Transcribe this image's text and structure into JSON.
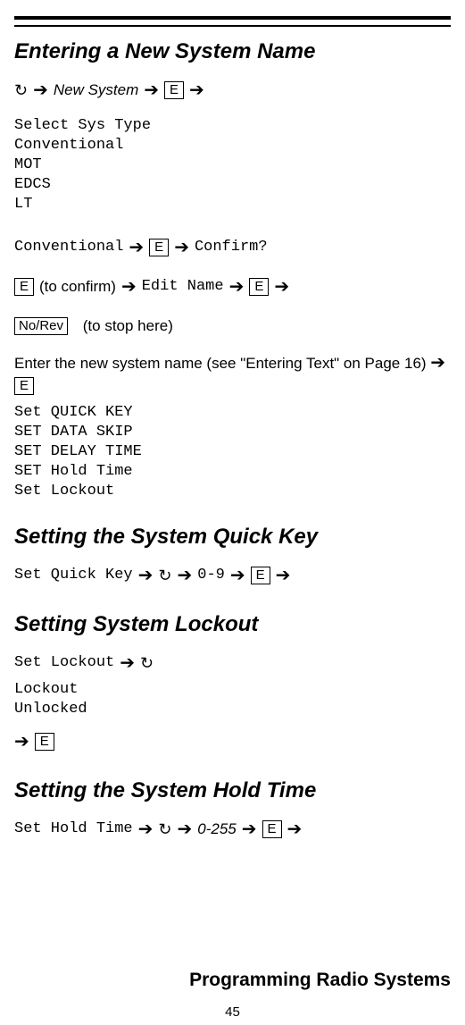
{
  "page_number": "45",
  "footer_title": "Programming Radio Systems",
  "symbols": {
    "arrow": "➔",
    "scroll": "↻",
    "key_E": "E",
    "key_NoRev": "No/Rev"
  },
  "section1": {
    "heading": "Entering a New System Name",
    "flow1_new_system": "New System",
    "sys_type_header": "Select Sys Type",
    "sys_types": [
      "Conventional",
      "MOT",
      "EDCS",
      "LT"
    ],
    "flow2_conventional": "Conventional",
    "flow2_confirm": "Confirm?",
    "flow3_to_confirm": "(to confirm)",
    "flow3_edit_name": "Edit Name",
    "flow4_to_stop": "(to stop here)",
    "enter_name_text": "Enter the new system name (see \"Entering Text\" on Page 16)",
    "set_list": [
      "Set QUICK KEY",
      "SET DATA SKIP",
      "SET DELAY TIME",
      "SET Hold Time",
      "Set Lockout"
    ]
  },
  "section2": {
    "heading": "Setting the System Quick Key",
    "flow_label": "Set Quick Key",
    "range": "0-9"
  },
  "section3": {
    "heading": "Setting System Lockout",
    "flow_label": "Set Lockout",
    "options": [
      "Lockout",
      "Unlocked"
    ]
  },
  "section4": {
    "heading": "Setting the System Hold Time",
    "flow_label": "Set Hold Time",
    "range": "0-255"
  }
}
